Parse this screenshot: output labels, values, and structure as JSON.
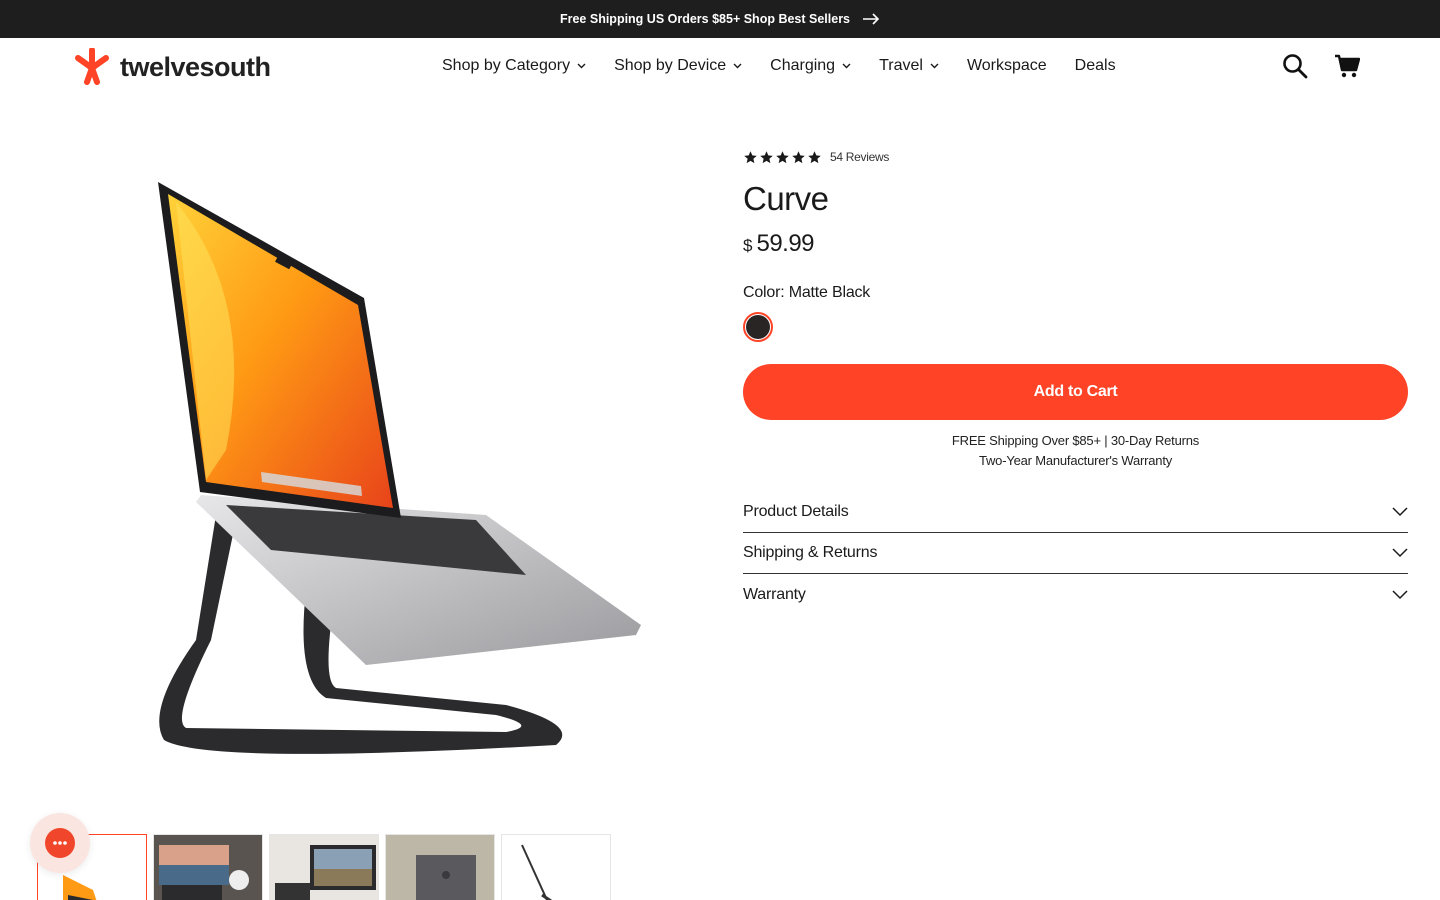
{
  "announcement": {
    "text": "Free Shipping US Orders $85+ Shop Best Sellers"
  },
  "brand": {
    "name": "twelvesouth",
    "accent": "#ff4326"
  },
  "nav": {
    "items": [
      {
        "label": "Shop by Category",
        "dropdown": true
      },
      {
        "label": "Shop by Device",
        "dropdown": true
      },
      {
        "label": "Charging",
        "dropdown": true
      },
      {
        "label": "Travel",
        "dropdown": true
      },
      {
        "label": "Workspace",
        "dropdown": false
      },
      {
        "label": "Deals",
        "dropdown": false
      }
    ],
    "icons": [
      "search-icon",
      "cart-icon"
    ]
  },
  "product": {
    "rating": 5,
    "reviews": "54 Reviews",
    "title": "Curve",
    "currency": "$",
    "price": "59.99",
    "color_label": "Color: Matte Black",
    "swatch_color": "#2a2525",
    "add_to_cart": "Add to Cart",
    "shipping_line1": "FREE Shipping Over $85+ | 30-Day Returns",
    "shipping_line2": "Two-Year Manufacturer's Warranty",
    "accordion": [
      {
        "label": "Product Details"
      },
      {
        "label": "Shipping & Returns"
      },
      {
        "label": "Warranty"
      }
    ]
  },
  "gallery": {
    "thumbnail_count": 5,
    "active_thumbnail": 1
  },
  "chat": {
    "icon": "chat-icon"
  }
}
